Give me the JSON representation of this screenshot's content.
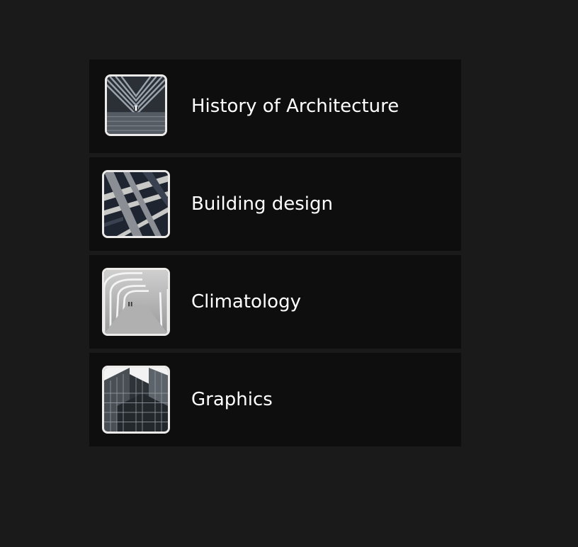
{
  "courses": [
    {
      "label": "History of Architecture",
      "thumbnail": "tunnel-perspective-image"
    },
    {
      "label": "Building design",
      "thumbnail": "diagonal-beams-image"
    },
    {
      "label": "Climatology",
      "thumbnail": "white-arched-corridor-image"
    },
    {
      "label": "Graphics",
      "thumbnail": "glass-towers-image"
    }
  ]
}
